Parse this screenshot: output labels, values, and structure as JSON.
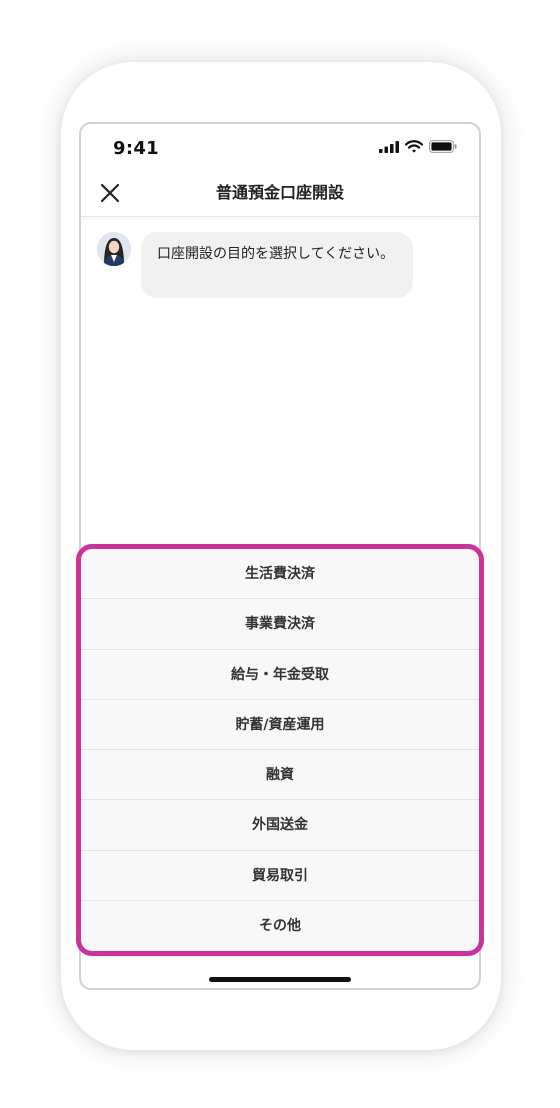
{
  "status_bar": {
    "time": "9:41",
    "icons": [
      "cellular-signal-icon",
      "wifi-icon",
      "battery-icon"
    ]
  },
  "header": {
    "title": "普通預金口座開設",
    "close_icon": "close-icon"
  },
  "chat": {
    "avatar": "operator-avatar",
    "message": "口座開設の目的を選択してください。"
  },
  "options": [
    {
      "label": "生活費決済"
    },
    {
      "label": "事業費決済"
    },
    {
      "label": "給与・年金受取"
    },
    {
      "label": "貯蓄/資産運用"
    },
    {
      "label": "融資"
    },
    {
      "label": "外国送金"
    },
    {
      "label": "貿易取引"
    },
    {
      "label": "その他"
    }
  ],
  "colors": {
    "highlight_border": "#cc3399",
    "bubble_bg": "#f1f1f1",
    "options_bg": "#f8f8f8"
  }
}
